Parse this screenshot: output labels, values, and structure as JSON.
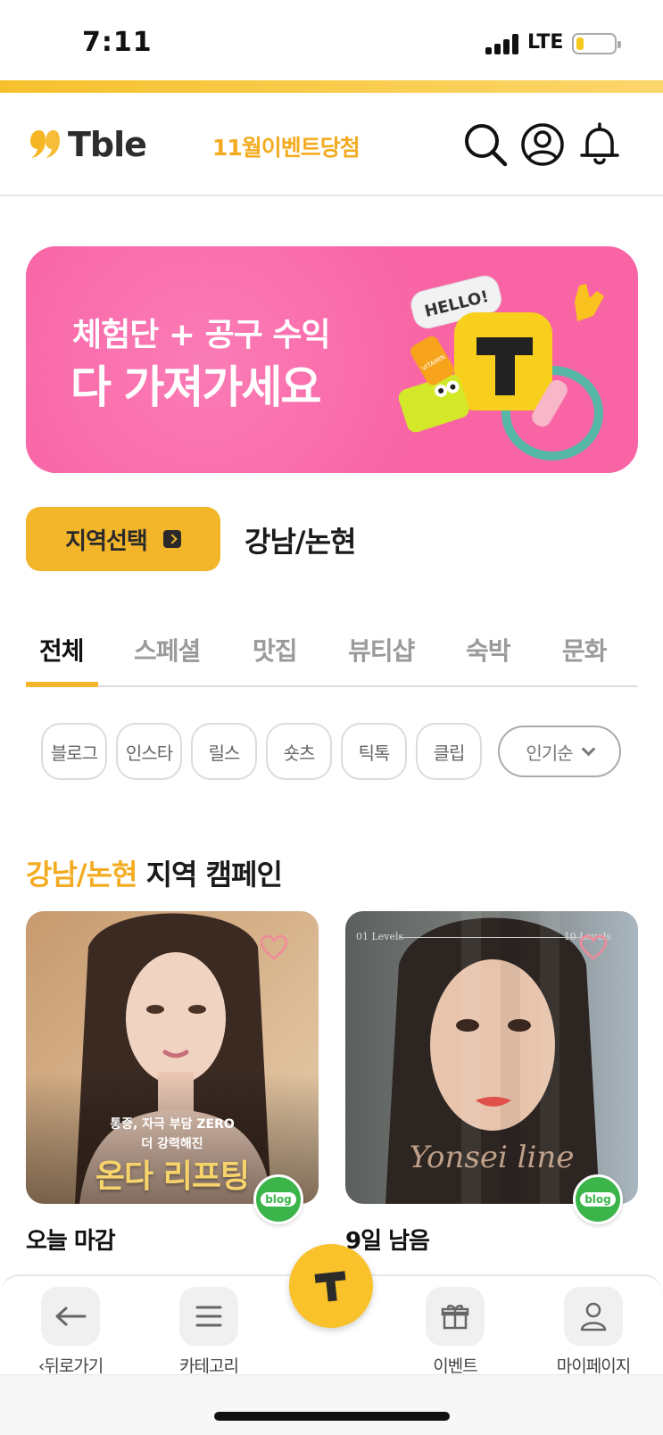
{
  "status_bar": {
    "time": "7:11",
    "carrier": "LTE",
    "battery_level": 0.18
  },
  "header": {
    "logo_text": "Tble",
    "event_link": "11월이벤트당첨",
    "icons": [
      "search-icon",
      "profile-icon",
      "bell-icon"
    ]
  },
  "banner": {
    "line1": "체험단 + 공구 수익",
    "line2": "다 가져가세요",
    "sticker_text": "HELLO!",
    "bottle_text": "VITAMIN"
  },
  "region": {
    "button_label": "지역선택",
    "selected": "강남/논현"
  },
  "tabs": [
    {
      "label": "전체",
      "active": true
    },
    {
      "label": "스페셜",
      "active": false
    },
    {
      "label": "맛집",
      "active": false
    },
    {
      "label": "뷰티샵",
      "active": false
    },
    {
      "label": "숙박",
      "active": false
    },
    {
      "label": "문화",
      "active": false
    }
  ],
  "chips": [
    "블로그",
    "인스타",
    "릴스",
    "숏츠",
    "틱톡",
    "클립"
  ],
  "sort": {
    "label": "인기순"
  },
  "section": {
    "highlight": "강남/논현",
    "title_rest": " 지역 캠페인"
  },
  "cards": [
    {
      "caption": "오늘 마감",
      "badge": "blog",
      "overlay_line1": "통증, 자극 부담 ZERO",
      "overlay_line2": "더 강력해진",
      "overlay_title": "온다 리프팅"
    },
    {
      "caption": "9일 남음",
      "badge": "blog",
      "level_left": "01 Levels",
      "level_right": "10 Levels",
      "script_text": "Yonsei line"
    }
  ],
  "bottom_nav": [
    {
      "label": "‹뒤로가기",
      "icon": "back-arrow-icon"
    },
    {
      "label": "카테고리",
      "icon": "menu-icon"
    },
    {
      "label": "이벤트",
      "icon": "gift-icon"
    },
    {
      "label": "마이페이지",
      "icon": "user-icon"
    }
  ],
  "colors": {
    "accent": "#f3b52a",
    "accent_text": "#f3ac22",
    "banner_pink": "#f964a5",
    "blog_green": "#3bb54a"
  }
}
